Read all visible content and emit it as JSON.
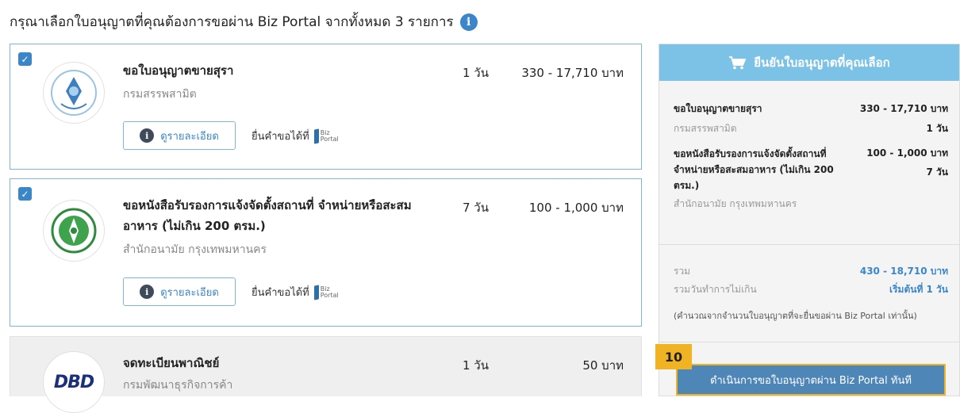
{
  "page": {
    "title": "กรุณาเลือกใบอนุญาตที่คุณต้องการขอผ่าน Biz Portal จากทั้งหมด 3 รายการ",
    "info_glyph": "i"
  },
  "permits": [
    {
      "checked": true,
      "check_glyph": "✓",
      "name": "ขอใบอนุญาตขายสุรา",
      "agency": "กรมสรรพสามิต",
      "days": "1 วัน",
      "fee": "330 - 17,710 บาท",
      "logo_icon": "excise-department-logo",
      "detail_label": "ดูรายละเอียด",
      "submit_label": "ยื่นคำขอได้ที่",
      "biz_top": "Biz",
      "biz_bottom": "Portal"
    },
    {
      "checked": true,
      "check_glyph": "✓",
      "name": "ขอหนังสือรับรองการแจ้งจัดตั้งสถานที่ จำหน่ายหรือสะสมอาหาร (ไม่เกิน 200 ตรม.)",
      "agency": "สำนักอนามัย กรุงเทพมหานคร",
      "days": "7 วัน",
      "fee": "100 - 1,000 บาท",
      "logo_icon": "bangkok-metropolitan-logo",
      "detail_label": "ดูรายละเอียด",
      "submit_label": "ยื่นคำขอได้ที่",
      "biz_top": "Biz",
      "biz_bottom": "Portal"
    },
    {
      "checked": false,
      "name": "จดทะเบียนพาณิชย์",
      "agency": "กรมพัฒนาธุรกิจการค้า",
      "days": "1 วัน",
      "fee": "50 บาท",
      "logo_icon": "dbd-logo",
      "logo_text": "DBD"
    }
  ],
  "summary": {
    "header": "ยืนยันใบอนุญาตที่คุณเลือก",
    "cart_icon": "cart-icon",
    "items": [
      {
        "name": "ขอใบอนุญาตขายสุรา",
        "fee": "330 - 17,710 บาท",
        "agency": "กรมสรรพสามิต",
        "days": "1 วัน"
      },
      {
        "name": "ขอหนังสือรับรองการแจ้งจัดตั้งสถานที่จำหน่ายหรือสะสมอาหาร (ไม่เกิน 200 ตรม.)",
        "fee": "100 - 1,000 บาท",
        "days": "7 วัน",
        "agency": "สำนักอนามัย กรุงเทพมหานคร"
      }
    ],
    "total_label": "รวม",
    "total_value": "430 - 18,710 บาท",
    "days_label": "รวมวันทำการไม่เกิน",
    "days_value": "เริ่มต้นที่ 1 วัน",
    "note": "(คำนวณจากจำนวนใบอนุญาตที่จะยื่นขอผ่าน Biz Portal เท่านั้น)",
    "proceed_label": "ดำเนินการขอใบอนุญาตผ่าน Biz Portal ทันที"
  },
  "step_badge": "10",
  "colors": {
    "accent": "#3a86c8",
    "header_bg": "#7cc1e6",
    "button_bg": "#4f86b8",
    "highlight": "#f0b323"
  }
}
